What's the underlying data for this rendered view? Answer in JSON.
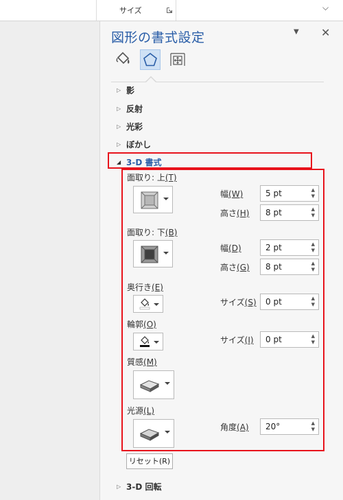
{
  "ribbon": {
    "size_group_label": "サイズ"
  },
  "pane": {
    "title": "図形の書式設定",
    "tabs": [
      {
        "name": "fill-and-line",
        "icon": "paint-bucket-icon"
      },
      {
        "name": "effects",
        "icon": "pentagon-icon",
        "selected": true
      },
      {
        "name": "size-and-properties",
        "icon": "size-properties-icon"
      }
    ],
    "sections": {
      "shadow": "影",
      "reflection": "反射",
      "glow": "光彩",
      "soft_edges": "ぼかし",
      "format_3d": "3-D 書式",
      "rotation_3d": "3-D 回転"
    },
    "format3d": {
      "top_bevel": {
        "label": "面取り: 上",
        "key": "(T)",
        "width_label": "幅",
        "width_key": "(W)",
        "width": "5 pt",
        "height_label": "高さ",
        "height_key": "(H)",
        "height": "8 pt"
      },
      "bottom_bevel": {
        "label": "面取り: 下",
        "key": "(B)",
        "width_label": "幅",
        "width_key": "(D)",
        "width": "2 pt",
        "height_label": "高さ",
        "height_key": "(G)",
        "height": "8 pt"
      },
      "depth": {
        "label": "奥行き",
        "key": "(E)",
        "size_label": "サイズ",
        "size_key": "(S)",
        "size": "0 pt"
      },
      "contour": {
        "label": "輪郭",
        "key": "(O)",
        "size_label": "サイズ",
        "size_key": "(I)",
        "size": "0 pt"
      },
      "material": {
        "label": "質感",
        "key": "(M)"
      },
      "lighting": {
        "label": "光源",
        "key": "(L)",
        "angle_label": "角度",
        "angle_key": "(A)",
        "angle": "20°"
      },
      "reset_label": "リセット(R)"
    }
  },
  "colors": {
    "accent": "#2a5ea8",
    "highlight": "#e8121b",
    "selected_tab_bg": "#cfe1f5"
  }
}
